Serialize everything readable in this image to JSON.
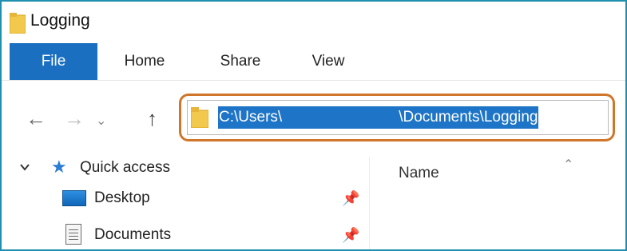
{
  "window": {
    "title": "Logging",
    "title_icon": "folder-icon"
  },
  "ribbon": {
    "tabs": [
      {
        "label": "File",
        "active": true
      },
      {
        "label": "Home"
      },
      {
        "label": "Share"
      },
      {
        "label": "View"
      }
    ]
  },
  "nav": {
    "back_icon": "arrow-left-icon",
    "forward_icon": "arrow-right-icon",
    "recent_icon": "chevron-down-icon",
    "up_icon": "arrow-up-icon",
    "address": {
      "path_prefix": "C:\\Users\\",
      "path_suffix": "\\Documents\\Logging",
      "selected": true,
      "highlight_color": "#1e74c6",
      "callout_color": "#d0762a"
    }
  },
  "navpane": {
    "quick_access": {
      "label": "Quick access",
      "expanded": true,
      "icon": "star-icon"
    },
    "items": [
      {
        "label": "Desktop",
        "icon": "desktop-icon",
        "pinned": true
      },
      {
        "label": "Documents",
        "icon": "documents-icon",
        "pinned": true
      }
    ]
  },
  "content": {
    "columns": [
      {
        "label": "Name",
        "sorted": "ascending"
      }
    ]
  },
  "colors": {
    "window_border": "#1f8fb0",
    "file_tab_bg": "#1a6fc1"
  }
}
